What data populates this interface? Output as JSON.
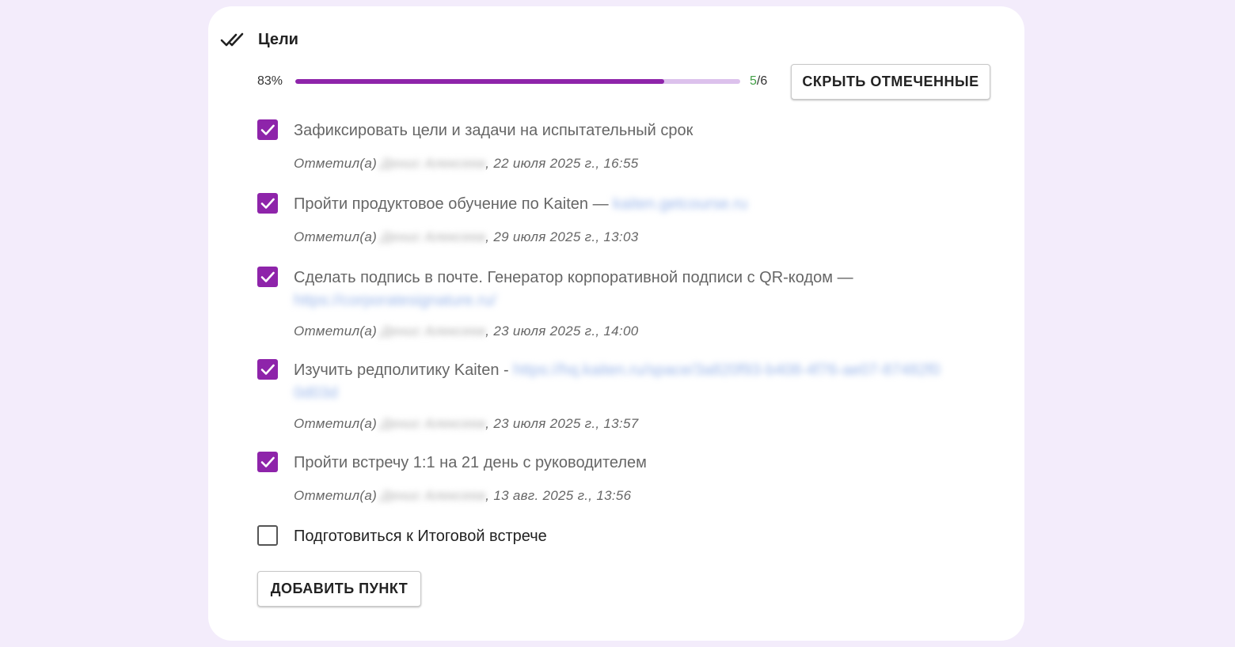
{
  "header": {
    "title": "Цели",
    "icon": "double-check-icon"
  },
  "progress": {
    "percent_label": "83%",
    "fraction": 0.83,
    "done": "5",
    "total": "/6",
    "fill_color": "#8e24aa",
    "track_color": "#dcc1ec"
  },
  "hide_button": {
    "label": "СКРЫТЬ ОТМЕЧЕННЫЕ"
  },
  "add_button": {
    "label": "ДОБАВИТЬ ПУНКТ"
  },
  "meta_prefix": "Отметил(а)",
  "items": [
    {
      "checked": true,
      "text": "Зафиксировать цели и задачи на испытательный срок",
      "link": "",
      "name": "Денис Алексеев",
      "date": ", 22 июля 2025 г., 16:55"
    },
    {
      "checked": true,
      "text": "Пройти продуктовое обучение по Kaiten — ",
      "link": "kaiten.getcourse.ru",
      "name": "Денис Алексеев",
      "date": ", 29 июля 2025 г., 13:03"
    },
    {
      "checked": true,
      "text": "Сделать подпись в почте. Генератор корпоративной подписи с QR-кодом — ",
      "link": "https://corporatesignature.ru/",
      "name": "Денис Алексеев",
      "date": ", 23 июля 2025 г., 14:00"
    },
    {
      "checked": true,
      "text": "Изучить редполитику Kaiten - ",
      "link": "https://hq.kaiten.ru/space/3a820f93-b408-4f76-ae07-87482f00d03d",
      "name": "Денис Алексеев",
      "date": ", 23 июля 2025 г., 13:57"
    },
    {
      "checked": true,
      "text": "Пройти встречу 1:1 на 21 день с руководителем",
      "link": "",
      "name": "Денис Алексеев",
      "date": ", 13 авг. 2025 г., 13:56"
    },
    {
      "checked": false,
      "text": "Подготовиться к Итоговой встрече",
      "link": "",
      "name": "",
      "date": ""
    }
  ]
}
